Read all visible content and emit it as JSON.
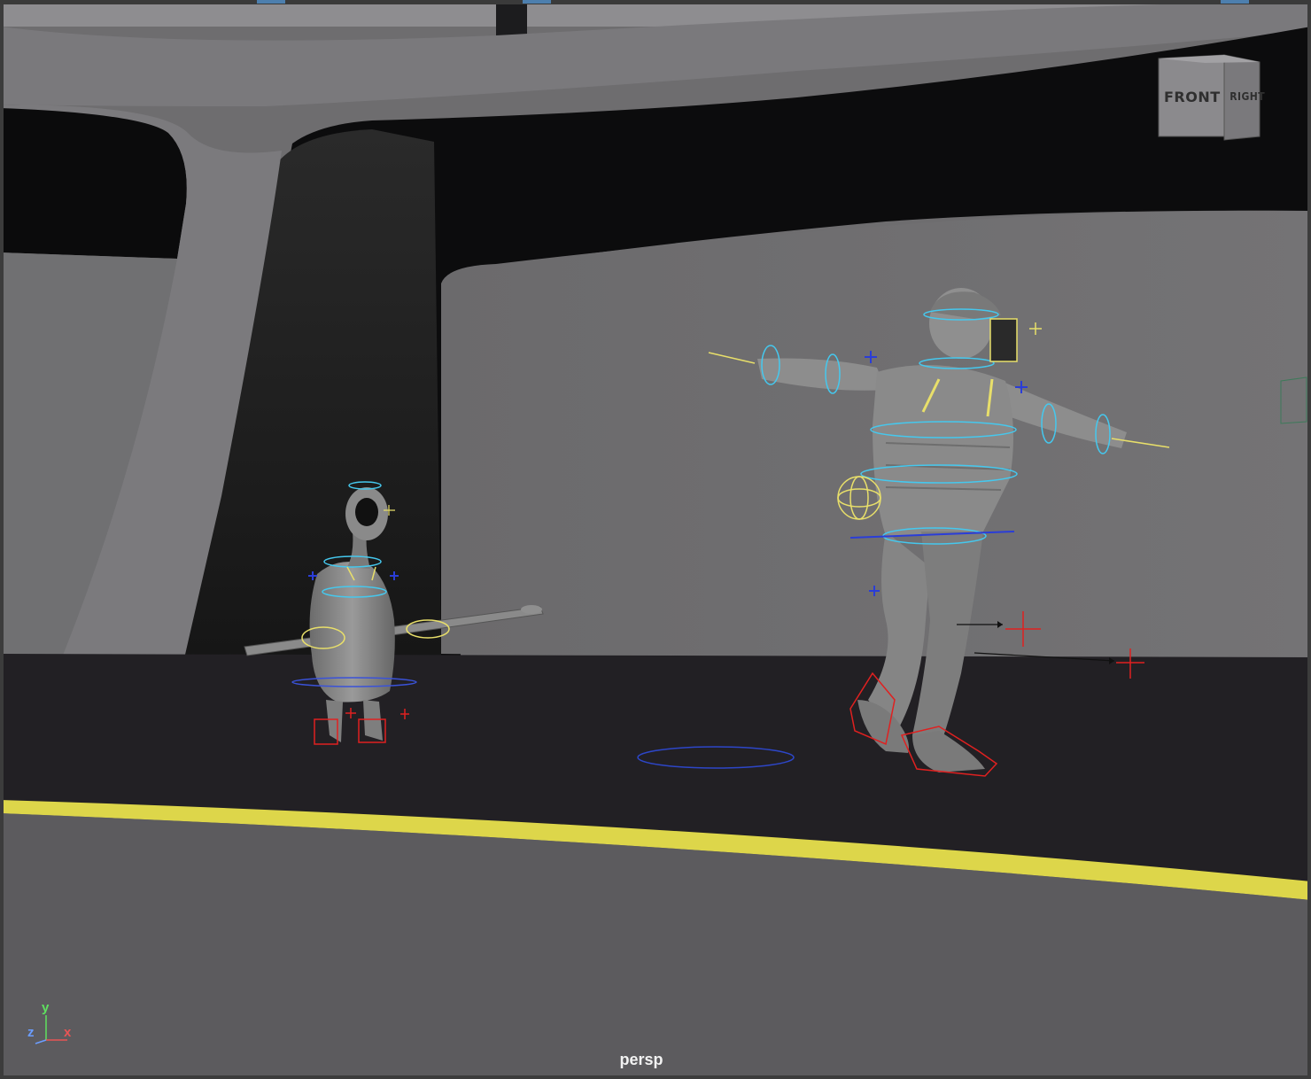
{
  "viewport": {
    "camera_name": "persp",
    "view_cube": {
      "front_label": "FRONT",
      "right_label": "RIGHT"
    },
    "axis_gizmo": {
      "x_label": "x",
      "y_label": "y",
      "z_label": "z"
    }
  },
  "colors": {
    "wall": "#6f6e70",
    "shadow": "#0b0b0b",
    "floor": "#222024",
    "ground": "#5c5b5e",
    "road_line": "#ddd64a",
    "control_cyan": "#45c8ee",
    "control_yellow": "#e8df6a",
    "control_red": "#e02020",
    "control_blue": "#2a3dd8"
  },
  "scene": {
    "characters": [
      {
        "name": "alien-character-rig"
      },
      {
        "name": "man-character-rig"
      }
    ]
  }
}
